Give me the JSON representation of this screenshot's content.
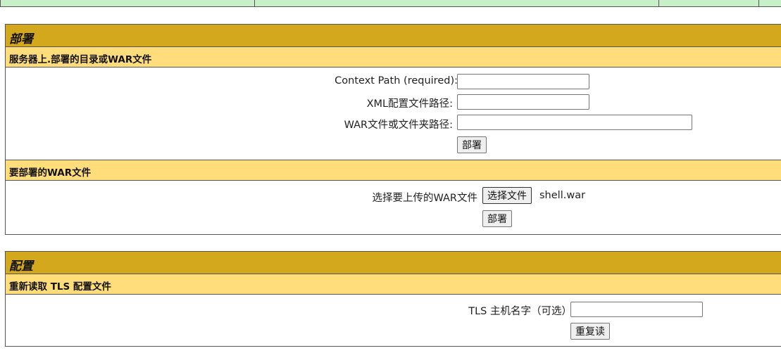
{
  "deploy": {
    "title": "部署",
    "server_dir": {
      "title": "服务器上.部署的目录或WAR文件",
      "context_path_label": "Context Path (required):",
      "context_path_value": "",
      "xml_path_label": "XML配置文件路径:",
      "xml_path_value": "",
      "war_path_label": "WAR文件或文件夹路径:",
      "war_path_value": "",
      "deploy_button": "部署"
    },
    "upload": {
      "title": "要部署的WAR文件",
      "choose_label": "选择要上传的WAR文件",
      "choose_button": "选择文件",
      "chosen_file": "shell.war",
      "deploy_button": "部署"
    }
  },
  "config": {
    "title": "配置",
    "tls": {
      "title": "重新读取 TLS 配置文件",
      "host_label": "TLS 主机名字（可选）",
      "host_value": "",
      "reload_button": "重复读"
    }
  },
  "colors": {
    "header_bg": "#d4a81c",
    "subheader_bg": "#ffdd7a",
    "top_table_bg": "#c8f0c8"
  }
}
